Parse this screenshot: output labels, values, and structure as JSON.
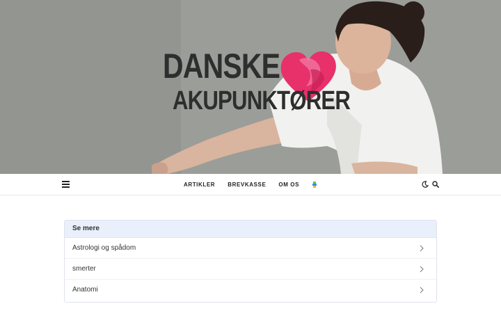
{
  "site": {
    "logo_line1": "DANSKE",
    "logo_line2": "AKUPUNKTØRER",
    "heart_color": "#e8306b"
  },
  "nav": {
    "items": [
      {
        "label": "ARTIKLER"
      },
      {
        "label": "BREVKASSE"
      },
      {
        "label": "OM OS"
      }
    ],
    "icons": [
      "menu-icon",
      "flag-icon",
      "moon-icon",
      "search-icon"
    ]
  },
  "see_more": {
    "title": "Se mere",
    "items": [
      {
        "label": "Astrologi og spådom"
      },
      {
        "label": "smerter"
      },
      {
        "label": "Anatomi"
      }
    ],
    "header_bg": "#e9effb"
  }
}
